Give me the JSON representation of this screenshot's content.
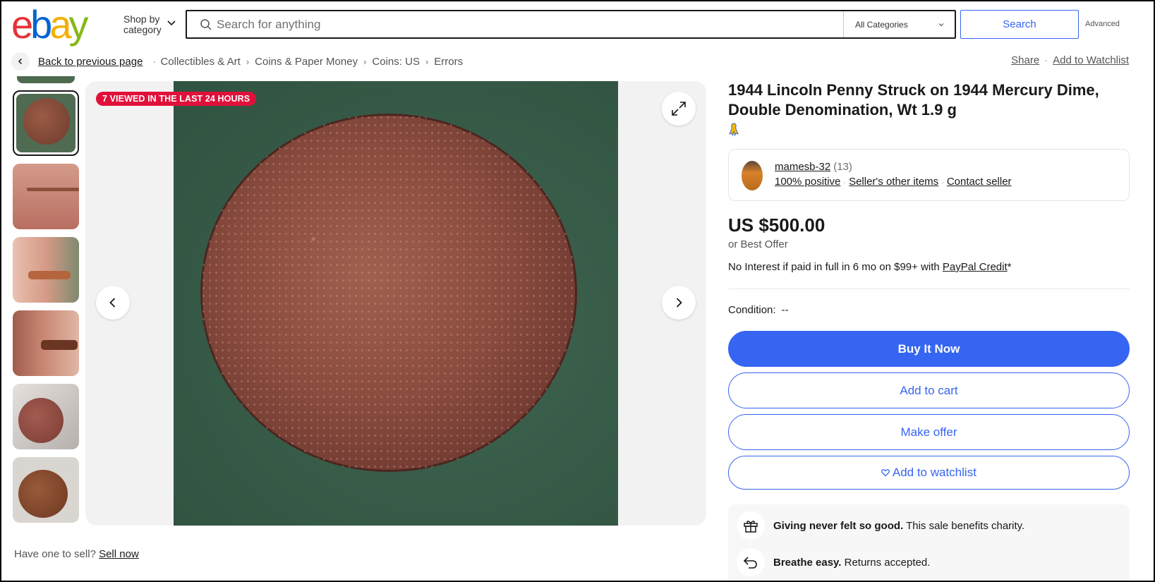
{
  "header": {
    "logo_letters": [
      "e",
      "b",
      "a",
      "y"
    ],
    "shop_by_line1": "Shop by",
    "shop_by_line2": "category",
    "search_placeholder": "Search for anything",
    "category_select": "All Categories",
    "search_button": "Search",
    "advanced_link": "Advanced"
  },
  "breadcrumb": {
    "back": "Back to previous page",
    "items": [
      "Collectibles & Art",
      "Coins & Paper Money",
      "Coins: US",
      "Errors"
    ]
  },
  "top_actions": {
    "share": "Share",
    "watchlist": "Add to Watchlist"
  },
  "gallery": {
    "viewed_badge": "7 VIEWED IN THE LAST 24 HOURS",
    "thumbnail_count": 6,
    "selected_index": 0
  },
  "sell": {
    "prompt": "Have one to sell?",
    "link": "Sell now"
  },
  "listing": {
    "title": "1944 Lincoln Penny Struck on 1944 Mercury Dime, Double Denomination, Wt 1.9 g",
    "price": "US $500.00",
    "best_offer": "or Best Offer",
    "credit_text": "No Interest if paid in full in 6 mo on $99+ with ",
    "credit_link": "PayPal Credit",
    "credit_suffix": "*",
    "condition_label": "Condition:",
    "condition_value": "--"
  },
  "seller": {
    "name": "mamesb-32",
    "feedback_count": "(13)",
    "positive": "100% positive",
    "other_items": "Seller's other items",
    "contact": "Contact seller"
  },
  "buttons": {
    "buy_now": "Buy It Now",
    "add_to_cart": "Add to cart",
    "make_offer": "Make offer",
    "add_to_watchlist": "Add to watchlist"
  },
  "benefits": {
    "charity_bold": "Giving never felt so good.",
    "charity_text": " This sale benefits charity.",
    "returns_bold": "Breathe easy.",
    "returns_text": " Returns accepted."
  },
  "colors": {
    "ebay_red": "#e53238",
    "ebay_blue": "#0064d2",
    "ebay_yellow": "#f5af02",
    "ebay_green": "#86b817",
    "primary": "#3665f3",
    "badge": "#e0103a"
  },
  "icons": [
    "search-icon",
    "chevron-down-icon",
    "back-arrow-icon",
    "expand-icon",
    "chevron-left-icon",
    "chevron-right-icon",
    "ribbon-icon",
    "heart-icon",
    "gift-icon",
    "return-arrow-icon"
  ]
}
